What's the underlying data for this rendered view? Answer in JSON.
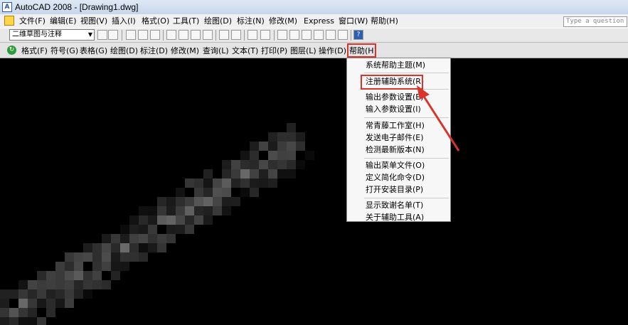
{
  "window": {
    "app_icon": "A",
    "title": "AutoCAD 2008 - [Drawing1.dwg]"
  },
  "menubar": {
    "app_icon": "autocad-menu-icon",
    "items": [
      "文件(F)",
      "编辑(E)",
      "视图(V)",
      "插入(I)",
      "格式(O)",
      "工具(T)",
      "绘图(D)",
      "标注(N)",
      "修改(M)",
      "Express",
      "窗口(W)",
      "帮助(H)"
    ],
    "ask_placeholder": "Type a question"
  },
  "toolbar1": {
    "workspace_value": "二维草图与注释",
    "workspace_arrow": "▼"
  },
  "toolbar2": {
    "icon": "↻",
    "items": [
      "格式(F)",
      "符号(G)",
      "表格(G)",
      "绘图(D)",
      "标注(D)",
      "修改(M)",
      "查询(L)",
      "文本(T)",
      "打印(P)",
      "图层(L)",
      "操作(D)",
      "帮助(H)"
    ]
  },
  "dropdown": {
    "items": [
      "系统帮助主题(M)",
      "注册辅助系统(R)",
      "输出参数设置(E)",
      "输入参数设置(I)",
      "常青藤工作室(H)",
      "发送电子邮件(E)",
      "检测最新版本(N)",
      "输出菜单文件(O)",
      "定义简化命令(D)",
      "打开安装目录(P)",
      "显示致谢名单(T)",
      "关于辅助工具(A)"
    ]
  },
  "colors": {
    "highlight": "#d9342b",
    "titlebar": "#c6d6ea",
    "canvas": "#000000"
  }
}
